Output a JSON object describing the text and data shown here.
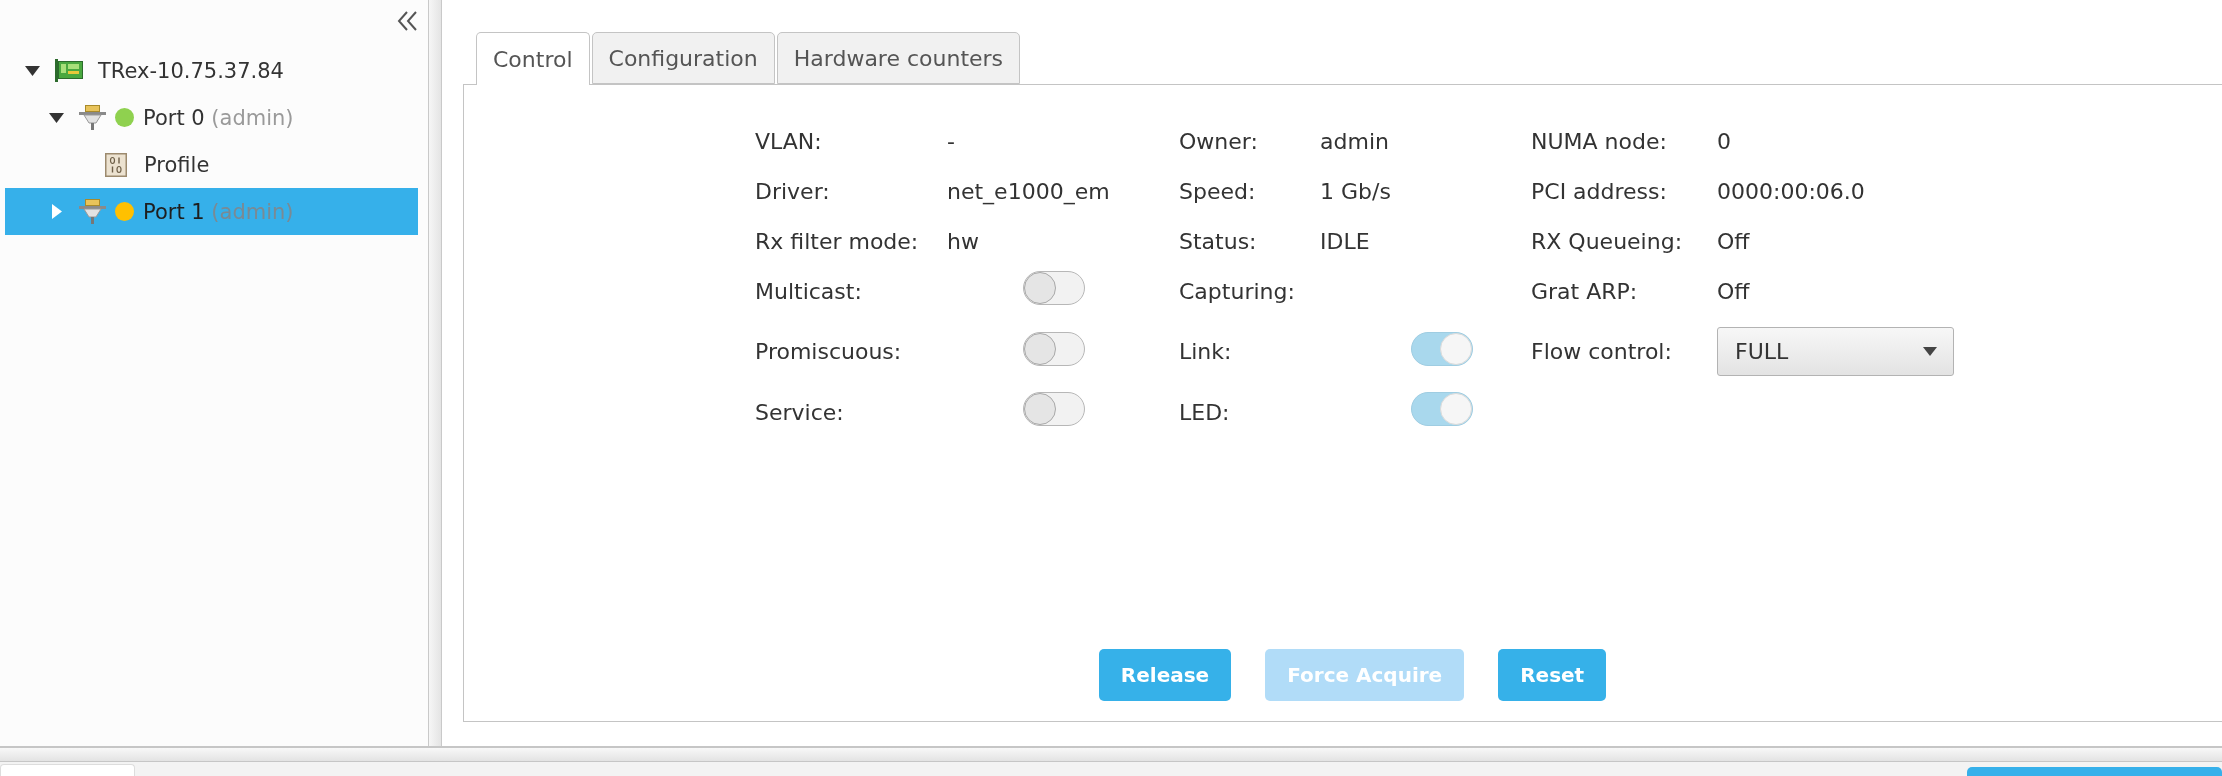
{
  "sidebar": {
    "tree": [
      {
        "kind": "server",
        "label": "TRex-10.75.37.84",
        "expanded": true,
        "selected": false,
        "children": [
          {
            "kind": "port",
            "label": "Port 0",
            "owner": "(admin)",
            "color": "#8fd14f",
            "expanded": true,
            "selected": false,
            "children": [
              {
                "kind": "profile",
                "label": "Profile",
                "selected": false
              }
            ]
          },
          {
            "kind": "port",
            "label": "Port 1",
            "owner": "(admin)",
            "color": "#ffc000",
            "expanded": false,
            "selected": true
          }
        ]
      }
    ]
  },
  "tabs": [
    {
      "label": "Control",
      "selected": true
    },
    {
      "label": "Configuration",
      "selected": false
    },
    {
      "label": "Hardware counters",
      "selected": false
    }
  ],
  "properties": [
    [
      {
        "kind": "text",
        "label": "VLAN:",
        "value": "-"
      },
      {
        "kind": "text",
        "label": "Owner:",
        "value": "admin"
      },
      {
        "kind": "text",
        "label": "NUMA node:",
        "value": "0"
      }
    ],
    [
      {
        "kind": "text",
        "label": "Driver:",
        "value": "net_e1000_em"
      },
      {
        "kind": "text",
        "label": "Speed:",
        "value": "1 Gb/s"
      },
      {
        "kind": "text",
        "label": "PCI address:",
        "value": "0000:00:06.0"
      }
    ],
    [
      {
        "kind": "text",
        "label": "Rx filter mode:",
        "value": "hw"
      },
      {
        "kind": "text",
        "label": "Status:",
        "value": "IDLE"
      },
      {
        "kind": "text",
        "label": "RX Queueing:",
        "value": "Off"
      }
    ],
    [
      {
        "kind": "toggle",
        "label": "Multicast:",
        "on": false
      },
      {
        "kind": "text",
        "label": "Capturing:"
      },
      {
        "kind": "text",
        "label": "Grat ARP:",
        "value": "Off"
      }
    ],
    [
      {
        "kind": "toggle",
        "label": "Promiscuous:",
        "on": false
      },
      {
        "kind": "toggle",
        "label": "Link:",
        "on": true
      },
      {
        "kind": "select",
        "label": "Flow control:",
        "value": "FULL"
      }
    ],
    [
      {
        "kind": "toggle",
        "label": "Service:",
        "on": false
      },
      {
        "kind": "toggle",
        "label": "LED:",
        "on": true
      }
    ]
  ],
  "buttons": [
    {
      "label": "Release",
      "disabled": false
    },
    {
      "label": "Force Acquire",
      "disabled": true
    },
    {
      "label": "Reset",
      "disabled": false
    }
  ]
}
